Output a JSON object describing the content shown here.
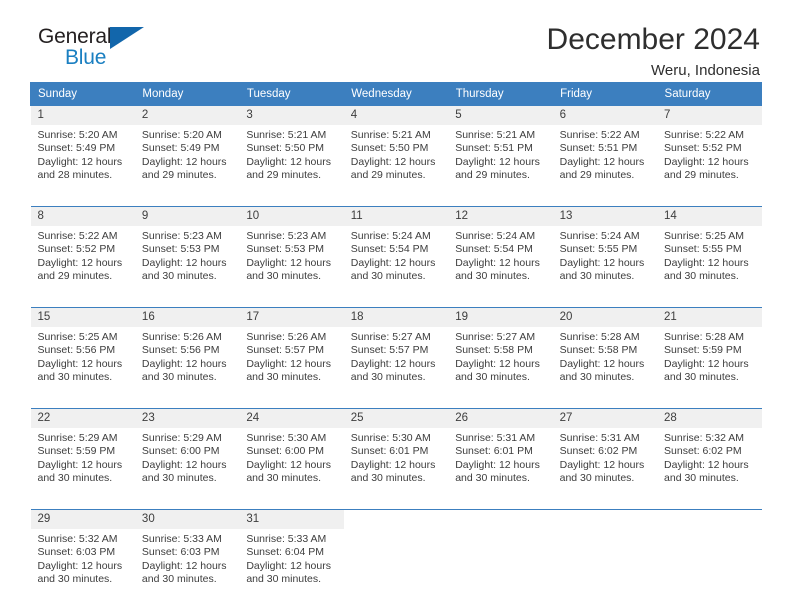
{
  "brand": {
    "name_top": "General",
    "name_bottom": "Blue",
    "triangle_color": "#1266ab",
    "blue_color": "#1a7fc1"
  },
  "header": {
    "title": "December 2024",
    "subtitle": "Weru, Indonesia"
  },
  "theme": {
    "header_blue": "#3c7fbf",
    "daynum_band": "#f0f0f0",
    "text": "#3d3d3d"
  },
  "calendar": {
    "weekday_headers": [
      "Sunday",
      "Monday",
      "Tuesday",
      "Wednesday",
      "Thursday",
      "Friday",
      "Saturday"
    ],
    "weeks": [
      [
        {
          "day": "1",
          "sunrise": "Sunrise: 5:20 AM",
          "sunset": "Sunset: 5:49 PM",
          "daylight_line1": "Daylight: 12 hours",
          "daylight_line2": "and 28 minutes."
        },
        {
          "day": "2",
          "sunrise": "Sunrise: 5:20 AM",
          "sunset": "Sunset: 5:49 PM",
          "daylight_line1": "Daylight: 12 hours",
          "daylight_line2": "and 29 minutes."
        },
        {
          "day": "3",
          "sunrise": "Sunrise: 5:21 AM",
          "sunset": "Sunset: 5:50 PM",
          "daylight_line1": "Daylight: 12 hours",
          "daylight_line2": "and 29 minutes."
        },
        {
          "day": "4",
          "sunrise": "Sunrise: 5:21 AM",
          "sunset": "Sunset: 5:50 PM",
          "daylight_line1": "Daylight: 12 hours",
          "daylight_line2": "and 29 minutes."
        },
        {
          "day": "5",
          "sunrise": "Sunrise: 5:21 AM",
          "sunset": "Sunset: 5:51 PM",
          "daylight_line1": "Daylight: 12 hours",
          "daylight_line2": "and 29 minutes."
        },
        {
          "day": "6",
          "sunrise": "Sunrise: 5:22 AM",
          "sunset": "Sunset: 5:51 PM",
          "daylight_line1": "Daylight: 12 hours",
          "daylight_line2": "and 29 minutes."
        },
        {
          "day": "7",
          "sunrise": "Sunrise: 5:22 AM",
          "sunset": "Sunset: 5:52 PM",
          "daylight_line1": "Daylight: 12 hours",
          "daylight_line2": "and 29 minutes."
        }
      ],
      [
        {
          "day": "8",
          "sunrise": "Sunrise: 5:22 AM",
          "sunset": "Sunset: 5:52 PM",
          "daylight_line1": "Daylight: 12 hours",
          "daylight_line2": "and 29 minutes."
        },
        {
          "day": "9",
          "sunrise": "Sunrise: 5:23 AM",
          "sunset": "Sunset: 5:53 PM",
          "daylight_line1": "Daylight: 12 hours",
          "daylight_line2": "and 30 minutes."
        },
        {
          "day": "10",
          "sunrise": "Sunrise: 5:23 AM",
          "sunset": "Sunset: 5:53 PM",
          "daylight_line1": "Daylight: 12 hours",
          "daylight_line2": "and 30 minutes."
        },
        {
          "day": "11",
          "sunrise": "Sunrise: 5:24 AM",
          "sunset": "Sunset: 5:54 PM",
          "daylight_line1": "Daylight: 12 hours",
          "daylight_line2": "and 30 minutes."
        },
        {
          "day": "12",
          "sunrise": "Sunrise: 5:24 AM",
          "sunset": "Sunset: 5:54 PM",
          "daylight_line1": "Daylight: 12 hours",
          "daylight_line2": "and 30 minutes."
        },
        {
          "day": "13",
          "sunrise": "Sunrise: 5:24 AM",
          "sunset": "Sunset: 5:55 PM",
          "daylight_line1": "Daylight: 12 hours",
          "daylight_line2": "and 30 minutes."
        },
        {
          "day": "14",
          "sunrise": "Sunrise: 5:25 AM",
          "sunset": "Sunset: 5:55 PM",
          "daylight_line1": "Daylight: 12 hours",
          "daylight_line2": "and 30 minutes."
        }
      ],
      [
        {
          "day": "15",
          "sunrise": "Sunrise: 5:25 AM",
          "sunset": "Sunset: 5:56 PM",
          "daylight_line1": "Daylight: 12 hours",
          "daylight_line2": "and 30 minutes."
        },
        {
          "day": "16",
          "sunrise": "Sunrise: 5:26 AM",
          "sunset": "Sunset: 5:56 PM",
          "daylight_line1": "Daylight: 12 hours",
          "daylight_line2": "and 30 minutes."
        },
        {
          "day": "17",
          "sunrise": "Sunrise: 5:26 AM",
          "sunset": "Sunset: 5:57 PM",
          "daylight_line1": "Daylight: 12 hours",
          "daylight_line2": "and 30 minutes."
        },
        {
          "day": "18",
          "sunrise": "Sunrise: 5:27 AM",
          "sunset": "Sunset: 5:57 PM",
          "daylight_line1": "Daylight: 12 hours",
          "daylight_line2": "and 30 minutes."
        },
        {
          "day": "19",
          "sunrise": "Sunrise: 5:27 AM",
          "sunset": "Sunset: 5:58 PM",
          "daylight_line1": "Daylight: 12 hours",
          "daylight_line2": "and 30 minutes."
        },
        {
          "day": "20",
          "sunrise": "Sunrise: 5:28 AM",
          "sunset": "Sunset: 5:58 PM",
          "daylight_line1": "Daylight: 12 hours",
          "daylight_line2": "and 30 minutes."
        },
        {
          "day": "21",
          "sunrise": "Sunrise: 5:28 AM",
          "sunset": "Sunset: 5:59 PM",
          "daylight_line1": "Daylight: 12 hours",
          "daylight_line2": "and 30 minutes."
        }
      ],
      [
        {
          "day": "22",
          "sunrise": "Sunrise: 5:29 AM",
          "sunset": "Sunset: 5:59 PM",
          "daylight_line1": "Daylight: 12 hours",
          "daylight_line2": "and 30 minutes."
        },
        {
          "day": "23",
          "sunrise": "Sunrise: 5:29 AM",
          "sunset": "Sunset: 6:00 PM",
          "daylight_line1": "Daylight: 12 hours",
          "daylight_line2": "and 30 minutes."
        },
        {
          "day": "24",
          "sunrise": "Sunrise: 5:30 AM",
          "sunset": "Sunset: 6:00 PM",
          "daylight_line1": "Daylight: 12 hours",
          "daylight_line2": "and 30 minutes."
        },
        {
          "day": "25",
          "sunrise": "Sunrise: 5:30 AM",
          "sunset": "Sunset: 6:01 PM",
          "daylight_line1": "Daylight: 12 hours",
          "daylight_line2": "and 30 minutes."
        },
        {
          "day": "26",
          "sunrise": "Sunrise: 5:31 AM",
          "sunset": "Sunset: 6:01 PM",
          "daylight_line1": "Daylight: 12 hours",
          "daylight_line2": "and 30 minutes."
        },
        {
          "day": "27",
          "sunrise": "Sunrise: 5:31 AM",
          "sunset": "Sunset: 6:02 PM",
          "daylight_line1": "Daylight: 12 hours",
          "daylight_line2": "and 30 minutes."
        },
        {
          "day": "28",
          "sunrise": "Sunrise: 5:32 AM",
          "sunset": "Sunset: 6:02 PM",
          "daylight_line1": "Daylight: 12 hours",
          "daylight_line2": "and 30 minutes."
        }
      ],
      [
        {
          "day": "29",
          "sunrise": "Sunrise: 5:32 AM",
          "sunset": "Sunset: 6:03 PM",
          "daylight_line1": "Daylight: 12 hours",
          "daylight_line2": "and 30 minutes."
        },
        {
          "day": "30",
          "sunrise": "Sunrise: 5:33 AM",
          "sunset": "Sunset: 6:03 PM",
          "daylight_line1": "Daylight: 12 hours",
          "daylight_line2": "and 30 minutes."
        },
        {
          "day": "31",
          "sunrise": "Sunrise: 5:33 AM",
          "sunset": "Sunset: 6:04 PM",
          "daylight_line1": "Daylight: 12 hours",
          "daylight_line2": "and 30 minutes."
        },
        {
          "day": "",
          "sunrise": "",
          "sunset": "",
          "daylight_line1": "",
          "daylight_line2": ""
        },
        {
          "day": "",
          "sunrise": "",
          "sunset": "",
          "daylight_line1": "",
          "daylight_line2": ""
        },
        {
          "day": "",
          "sunrise": "",
          "sunset": "",
          "daylight_line1": "",
          "daylight_line2": ""
        },
        {
          "day": "",
          "sunrise": "",
          "sunset": "",
          "daylight_line1": "",
          "daylight_line2": ""
        }
      ]
    ]
  }
}
